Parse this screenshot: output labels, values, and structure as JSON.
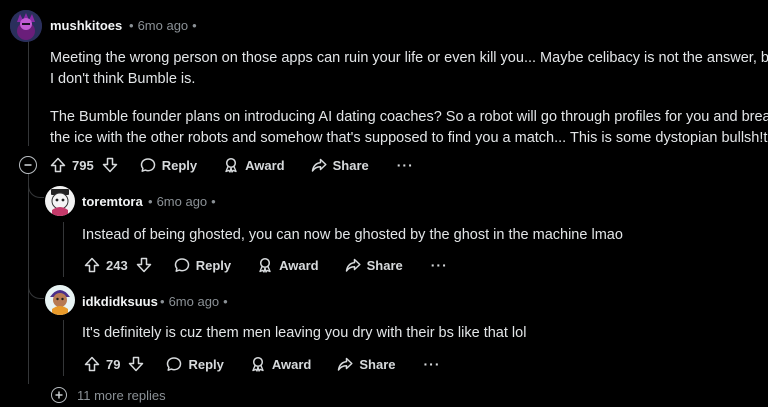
{
  "colors": {
    "background": "#000000",
    "text": "#e3e6e8",
    "muted": "#8b9196",
    "thread_line": "#343638"
  },
  "comment_main": {
    "username": "mushkitoes",
    "separator": "•",
    "age": "6mo ago",
    "trailing_dot": "•",
    "paragraphs": [
      "Meeting the wrong person on those apps can ruin your life or even kill you... Maybe celibacy is not the answer, but",
      "I don't think Bumble is.",
      "The Bumble founder plans on introducing AI dating coaches? So a robot will go through profiles for you and break",
      "the ice with the other robots and somehow that's supposed to find you a match... This is some dystopian bullsh!t"
    ],
    "votes": "795",
    "reply_label": "Reply",
    "award_label": "Award",
    "share_label": "Share",
    "more_label": "···"
  },
  "reply_1": {
    "username": "toremtora",
    "separator": "•",
    "age": "6mo ago",
    "trailing_dot": "•",
    "text": "Instead of being ghosted, you can now be ghosted by the ghost in the machine lmao",
    "votes": "243",
    "reply_label": "Reply",
    "award_label": "Award",
    "share_label": "Share",
    "more_label": "···"
  },
  "reply_2": {
    "username": "idkdidksuus",
    "separator": "•",
    "age": "6mo ago",
    "trailing_dot": "•",
    "text": "It's definitely is cuz them men leaving you dry with their bs like that lol",
    "votes": "79",
    "reply_label": "Reply",
    "award_label": "Award",
    "share_label": "Share",
    "more_label": "···"
  },
  "more_replies_label": "11 more replies",
  "icons": [
    "collapse-icon",
    "upvote-icon",
    "downvote-icon",
    "reply-icon",
    "award-icon",
    "share-icon",
    "expand-icon"
  ]
}
